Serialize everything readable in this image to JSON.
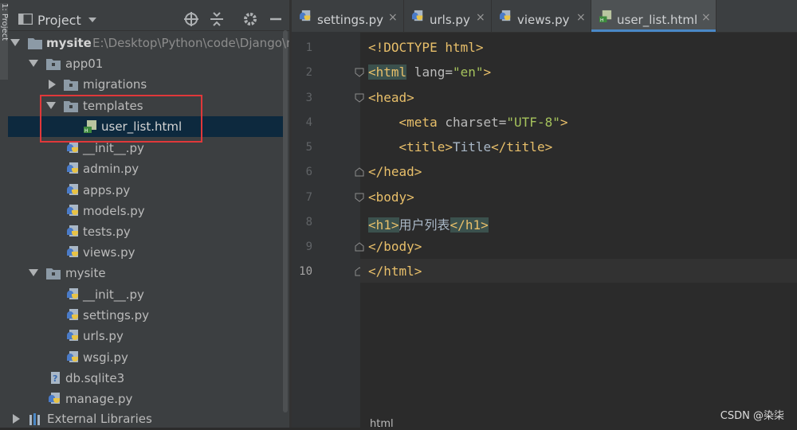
{
  "side_strip": {
    "label": "1: Project"
  },
  "project_panel": {
    "title": "Project",
    "tree": [
      {
        "label": "mysite",
        "path": "E:\\Desktop\\Python\\code\\Django\\my"
      },
      {
        "label": "app01"
      },
      {
        "label": "migrations"
      },
      {
        "label": "templates"
      },
      {
        "label": "user_list.html"
      },
      {
        "label": "__init__.py"
      },
      {
        "label": "admin.py"
      },
      {
        "label": "apps.py"
      },
      {
        "label": "models.py"
      },
      {
        "label": "tests.py"
      },
      {
        "label": "views.py"
      },
      {
        "label": "mysite"
      },
      {
        "label": "__init__.py"
      },
      {
        "label": "settings.py"
      },
      {
        "label": "urls.py"
      },
      {
        "label": "wsgi.py"
      },
      {
        "label": "db.sqlite3"
      },
      {
        "label": "manage.py"
      },
      {
        "label": "External Libraries"
      }
    ]
  },
  "tabs": [
    {
      "label": "settings.py",
      "close": "×"
    },
    {
      "label": "urls.py",
      "close": "×"
    },
    {
      "label": "views.py",
      "close": "×"
    },
    {
      "label": "user_list.html",
      "close": "×"
    }
  ],
  "editor": {
    "line_numbers": [
      "1",
      "2",
      "3",
      "4",
      "5",
      "6",
      "7",
      "8",
      "9",
      "10"
    ],
    "code": {
      "l1": "<!DOCTYPE html>",
      "l2_open": "<html",
      "l2_attr": " lang=",
      "l2_val": "\"en\"",
      "l2_close": ">",
      "l3": "<head>",
      "l4_indent": "    ",
      "l4_open": "<meta",
      "l4_attr": " charset=",
      "l4_val": "\"UTF-8\"",
      "l4_close": ">",
      "l5_indent": "    ",
      "l5_open": "<title>",
      "l5_text": "Title",
      "l5_close": "</title>",
      "l6": "</head>",
      "l7": "<body>",
      "l8_open": "<h1>",
      "l8_text": "用户列表",
      "l8_close": "</h1>",
      "l9": "</body>",
      "l10": "</html>"
    },
    "breadcrumb": "html"
  },
  "watermark": "CSDN @染柒"
}
